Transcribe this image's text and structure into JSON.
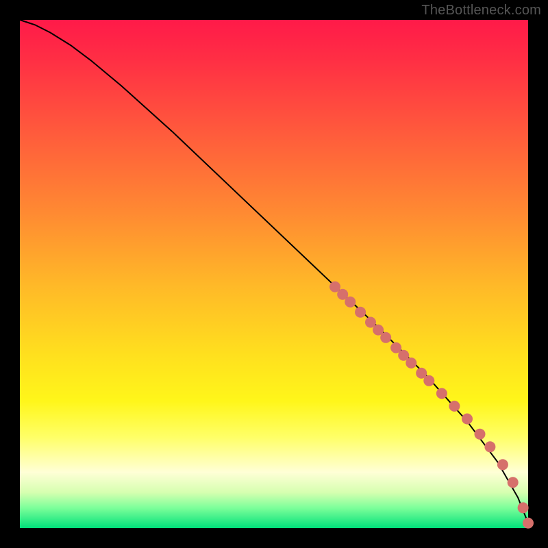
{
  "watermark": "TheBottleneck.com",
  "chart_data": {
    "type": "line",
    "title": "",
    "xlabel": "",
    "ylabel": "",
    "xlim": [
      0,
      100
    ],
    "ylim": [
      0,
      100
    ],
    "note": "Monotone decreasing curve from top-left to bottom-right with a cluster of circular markers along the lower-right third of the curve. Axes have no visible tick labels; values are normalized 0–100 by position.",
    "series": [
      {
        "name": "curve",
        "kind": "line",
        "x": [
          0,
          3,
          6,
          10,
          14,
          20,
          30,
          40,
          50,
          60,
          70,
          80,
          88,
          94,
          98,
          100
        ],
        "y": [
          100,
          99,
          97.5,
          95,
          92,
          87,
          78,
          68.5,
          59,
          49.5,
          40,
          30,
          21,
          13,
          6,
          1
        ]
      },
      {
        "name": "markers",
        "kind": "scatter",
        "x": [
          62,
          63.5,
          65,
          67,
          69,
          70.5,
          72,
          74,
          75.5,
          77,
          79,
          80.5,
          83,
          85.5,
          88,
          90.5,
          92.5,
          95,
          97,
          99,
          100
        ],
        "y": [
          47.5,
          46,
          44.5,
          42.5,
          40.5,
          39,
          37.5,
          35.5,
          34,
          32.5,
          30.5,
          29,
          26.5,
          24,
          21.5,
          18.5,
          16,
          12.5,
          9,
          4,
          1
        ]
      }
    ],
    "colors": {
      "curve": "#000000",
      "marker_fill": "#d6706b",
      "marker_stroke": "#b85a55",
      "gradient_top": "#ff1a49",
      "gradient_bottom": "#00e07a"
    }
  }
}
